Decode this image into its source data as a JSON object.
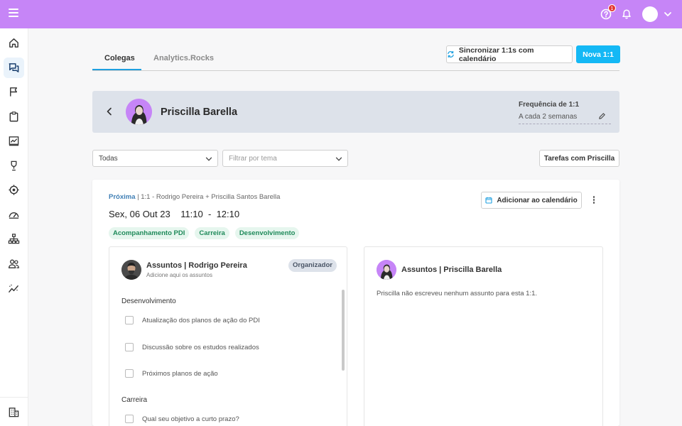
{
  "topbar": {
    "notification_count": "1",
    "accent_color": "#c685f7"
  },
  "sidebar": {
    "items": [
      {
        "icon": "home-icon"
      },
      {
        "icon": "chat-icon",
        "active": true
      },
      {
        "icon": "flag-icon"
      },
      {
        "icon": "clipboard-icon"
      },
      {
        "icon": "chart-icon"
      },
      {
        "icon": "trophy-icon"
      },
      {
        "icon": "target-icon"
      },
      {
        "icon": "gauge-icon"
      },
      {
        "icon": "org-chart-icon"
      },
      {
        "icon": "people-icon"
      },
      {
        "icon": "trend-icon"
      }
    ],
    "bottom_icon": "building-icon"
  },
  "tabs": [
    {
      "label": "Colegas",
      "active": true
    },
    {
      "label": "Analytics.Rocks",
      "active": false
    }
  ],
  "header_actions": {
    "sync_label": "Sincronizar 1:1s com calendário",
    "new_label": "Nova 1:1"
  },
  "profile": {
    "name": "Priscilla Barella",
    "frequency_title": "Frequência de 1:1",
    "frequency_value": "A cada 2 semanas"
  },
  "filters": {
    "status_value": "Todas",
    "theme_placeholder": "Filtrar por tema",
    "tasks_label": "Tarefas com Priscilla"
  },
  "meeting": {
    "next_label": "Próxima",
    "participants": " | 1:1 - Rodrigo Pereira + Priscilla Santos Barella",
    "date": "Sex, 06 Out 23",
    "time_start": "11:10",
    "time_sep": "-",
    "time_end": "12:10",
    "calendar_button": "Adicionar ao calendário",
    "tags": [
      "Acompanhamento PDI",
      "Carreira",
      "Desenvolvimento"
    ]
  },
  "left_panel": {
    "title": "Assuntos | Rodrigo Pereira",
    "subtitle": "Adicione aqui os assuntos",
    "badge": "Organizador",
    "section_1": "Desenvolvimento",
    "items_1": [
      "Atualização dos planos de ação do PDI",
      "Discussão sobre os estudos realizados",
      "Próximos planos de ação"
    ],
    "section_2": "Carreira",
    "items_2": [
      "Qual seu objetivo a curto prazo?"
    ]
  },
  "right_panel": {
    "title": "Assuntos | Priscilla Barella",
    "empty_message": "Priscilla não escreveu nenhum assunto para esta 1:1."
  }
}
